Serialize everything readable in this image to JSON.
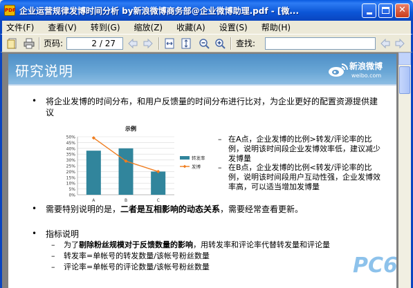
{
  "window": {
    "title": "企业运营规律发博时间分析 by新浪微博商务部@企业微博助理.pdf - [微...",
    "app_icon_text": "PDF"
  },
  "menu": [
    "文件(F)",
    "查看(V)",
    "转到(G)",
    "缩放(Z)",
    "收藏(A)",
    "设置(S)",
    "帮助(H)"
  ],
  "toolbar": {
    "page_label": "页码:",
    "page_value": "2 / 27",
    "find_label": "查找:"
  },
  "slide": {
    "title": "研究说明",
    "logo_name": "新浪微博",
    "logo_url": "weibo.com",
    "bullet1": "将企业发博的时间分布，和用户反馈量的时间分布进行比对，为企业更好的配置资源提供建议",
    "note1": "在A点，企业发博的比例>转发/评论率的比例，说明该时间段企业发博效率低，建议减少发博量",
    "note2": "在B点，企业发博的比例<转发/评论率的比例，说明该时间段用户互动性强，企业发博效率高，可以适当增加发博量",
    "bullet2_pre": "需要特别说明的是，",
    "bullet2_bold": "二者是互相影响的动态关系",
    "bullet2_post": "，需要经常查看更新。",
    "bullet3": "指标说明",
    "sub1_pre": "为了",
    "sub1_bold": "剔除粉丝规模对于反馈数量的影响",
    "sub1_post": "，用转发率和评论率代替转发量和评论量",
    "sub2": "转发率=单帐号的转发数量/该帐号粉丝数量",
    "sub3": "评论率=单帐号的评论数量/该帐号粉丝数量",
    "bullet_symbol": "•",
    "dash_symbol": "–",
    "watermark": "PC6"
  },
  "chart_data": {
    "type": "bar",
    "title": "示例",
    "categories": [
      "A",
      "B",
      "C"
    ],
    "series": [
      {
        "name": "转发率",
        "type": "bar",
        "values": [
          0.38,
          0.4,
          0.2
        ],
        "color": "#31859c"
      },
      {
        "name": "发博",
        "type": "line",
        "values": [
          0.49,
          0.29,
          0.2
        ],
        "color": "#f07d1f"
      }
    ],
    "yticks": [
      "50%",
      "45%",
      "40%",
      "35%",
      "30%",
      "25%",
      "20%",
      "15%",
      "10%",
      "5%",
      "0%"
    ],
    "ylim": [
      0,
      0.5
    ],
    "legend": "right"
  }
}
